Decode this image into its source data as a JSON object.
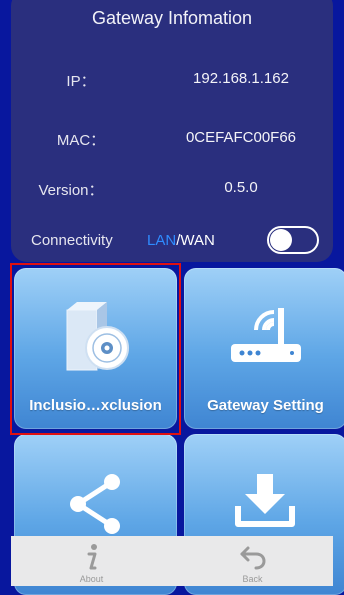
{
  "gateway": {
    "title": "Gateway Infomation",
    "ip_label": "IP：",
    "ip_value": "192.168.1.162",
    "mac_label": "MAC：",
    "mac_value": "0CEFAFC00F66",
    "version_label": "Version：",
    "version_value": "0.5.0",
    "connectivity_label": "Connectivity",
    "connectivity_lan": "LAN",
    "connectivity_sep": "/",
    "connectivity_wan": "WAN",
    "toggle_on": false
  },
  "tiles": [
    {
      "label": "Inclusio…xclusion",
      "icon": "software-box-disc-icon",
      "selected": true
    },
    {
      "label": "Gateway Setting",
      "icon": "router-icon",
      "selected": false
    },
    {
      "label": "",
      "icon": "share-icon",
      "selected": false
    },
    {
      "label": "",
      "icon": "download-icon",
      "selected": false
    }
  ],
  "tabbar": {
    "about": {
      "label": "About",
      "icon": "info-icon"
    },
    "back": {
      "label": "Back",
      "icon": "back-arrow-icon"
    }
  },
  "colors": {
    "background": "#08179e",
    "card": "#2a2f7e",
    "lan": "#2f8cff",
    "tile_top": "#9fd0f7",
    "tile_bottom": "#3f85d2",
    "selection": "#e01010",
    "tabbar": "#e9e9ea"
  }
}
